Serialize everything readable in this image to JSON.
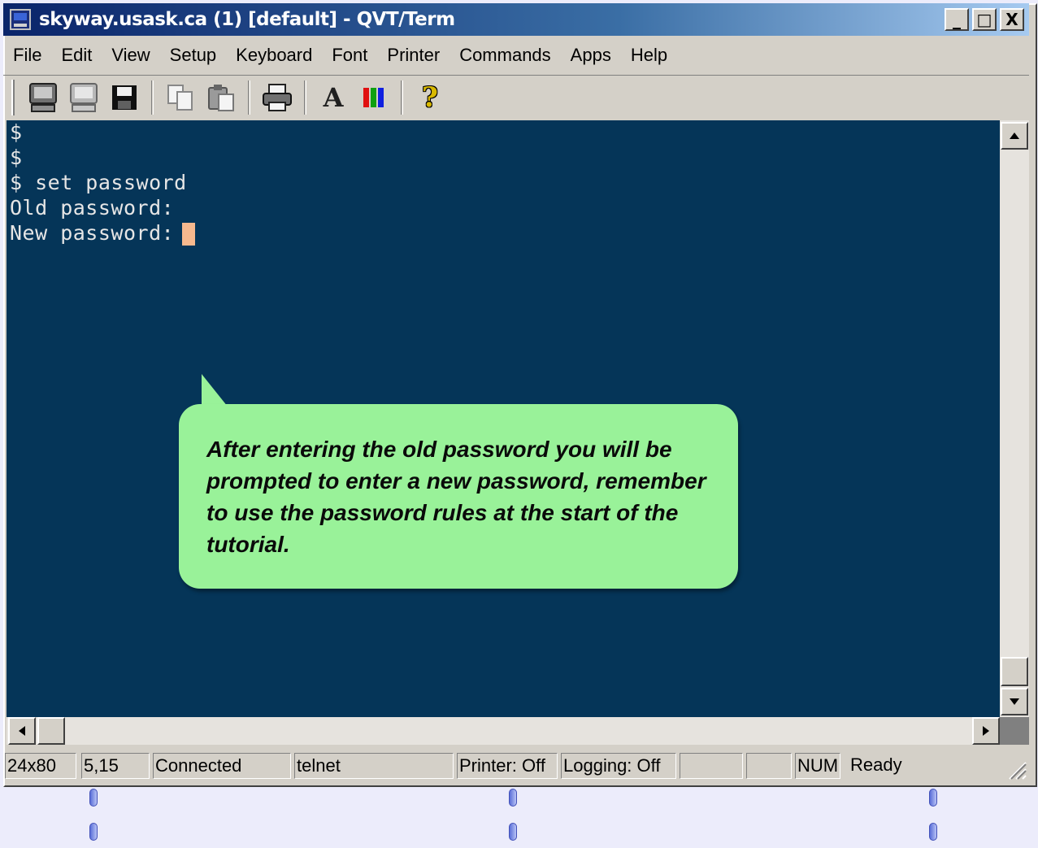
{
  "window": {
    "title": "skyway.usask.ca (1) [default] - QVT/Term",
    "controls": [
      "_",
      "□",
      "X"
    ]
  },
  "menu": [
    "File",
    "Edit",
    "View",
    "Setup",
    "Keyboard",
    "Font",
    "Printer",
    "Commands",
    "Apps",
    "Help"
  ],
  "toolbar": {
    "icons": [
      "connect-icon",
      "disconnect-icon",
      "save-icon",
      "copy-icon",
      "paste-icon",
      "print-icon",
      "font-icon",
      "colors-icon",
      "help-icon"
    ],
    "font_glyph": "A",
    "help_glyph": "?"
  },
  "terminal": {
    "lines": [
      "$",
      "$",
      "$ set password",
      "Old password:",
      "New password:"
    ],
    "background": "#053558",
    "cursor_color": "#f7b98e"
  },
  "callout": {
    "text": "After entering the old password you will be prompted to enter a new password, remember to use the password rules at the start of the tutorial.",
    "background": "#99f299"
  },
  "status": {
    "size": "24x80",
    "position": "5,15",
    "connection": "Connected",
    "protocol": "telnet",
    "printer": "Printer: Off",
    "logging": "Logging: Off",
    "blank1": "",
    "blank2": "",
    "num": "NUM",
    "ready": "Ready"
  }
}
